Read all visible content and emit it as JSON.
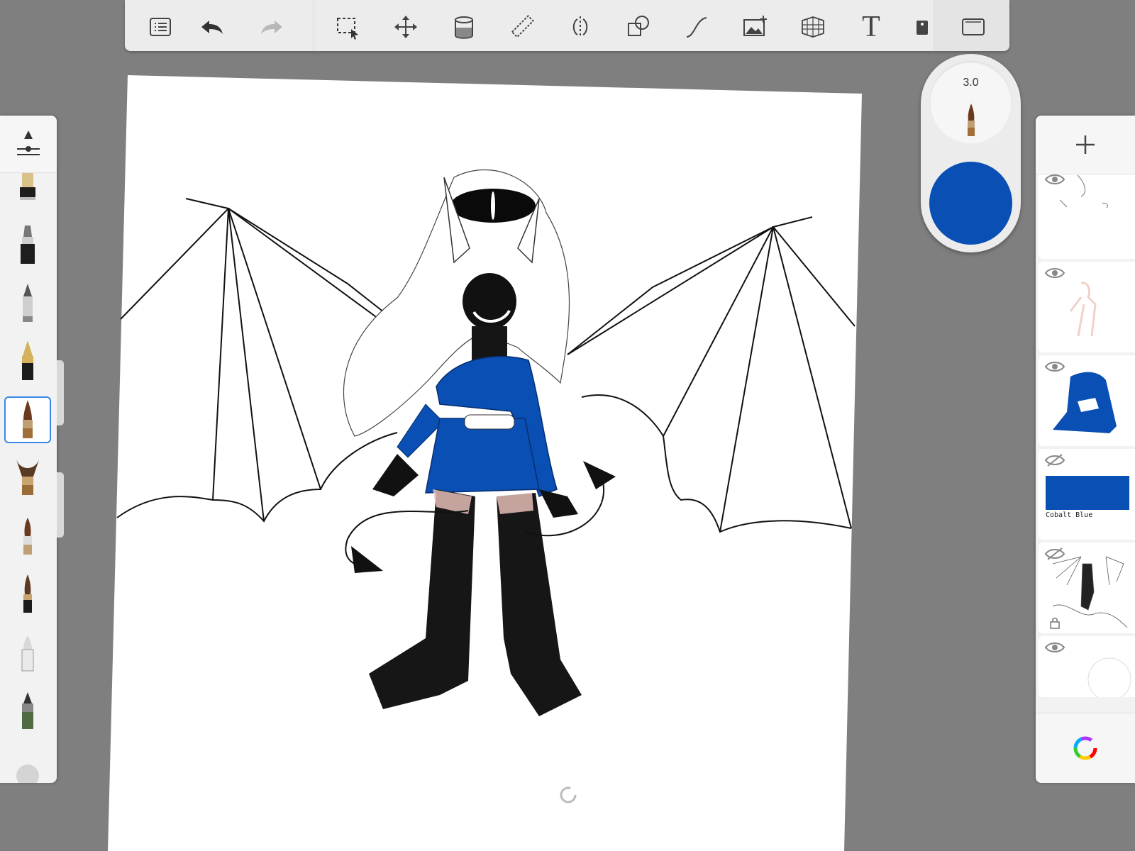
{
  "toolbar": {
    "tools": [
      {
        "name": "list-icon"
      },
      {
        "name": "undo-icon"
      },
      {
        "name": "redo-icon"
      },
      {
        "name": "selection-icon"
      },
      {
        "name": "transform-icon"
      },
      {
        "name": "fill-icon"
      },
      {
        "name": "ruler-icon"
      },
      {
        "name": "symmetry-icon"
      },
      {
        "name": "shapes-icon"
      },
      {
        "name": "curve-icon"
      },
      {
        "name": "image-add-icon"
      },
      {
        "name": "perspective-icon"
      },
      {
        "name": "text-icon",
        "glyph": "T"
      },
      {
        "name": "stencil-icon"
      },
      {
        "name": "fullscreen-icon"
      }
    ]
  },
  "brush_puck": {
    "size_label": "3.0",
    "color": "#0a4fb3"
  },
  "brushes": [
    {
      "name": "marker-brush"
    },
    {
      "name": "felt-pen-brush"
    },
    {
      "name": "pencil-brush"
    },
    {
      "name": "fountain-pen-brush"
    },
    {
      "name": "paint-brush",
      "selected": true
    },
    {
      "name": "airbrush-brush"
    },
    {
      "name": "round-brush"
    },
    {
      "name": "ink-brush"
    },
    {
      "name": "eraser-brush"
    },
    {
      "name": "fineliner-brush"
    },
    {
      "name": "blender-brush"
    }
  ],
  "layers": [
    {
      "name": "layer-sketch-lines",
      "visible": true
    },
    {
      "name": "layer-skin",
      "visible": true
    },
    {
      "name": "layer-blue-clothes",
      "visible": true
    },
    {
      "name": "layer-cobalt-blue",
      "visible": false,
      "label": "Cobalt Blue"
    },
    {
      "name": "layer-reference",
      "visible": false,
      "locked": true
    },
    {
      "name": "layer-background",
      "visible": true
    }
  ],
  "colors": {
    "accent": "#3a88e8",
    "cobalt": "#0a4fb3"
  }
}
